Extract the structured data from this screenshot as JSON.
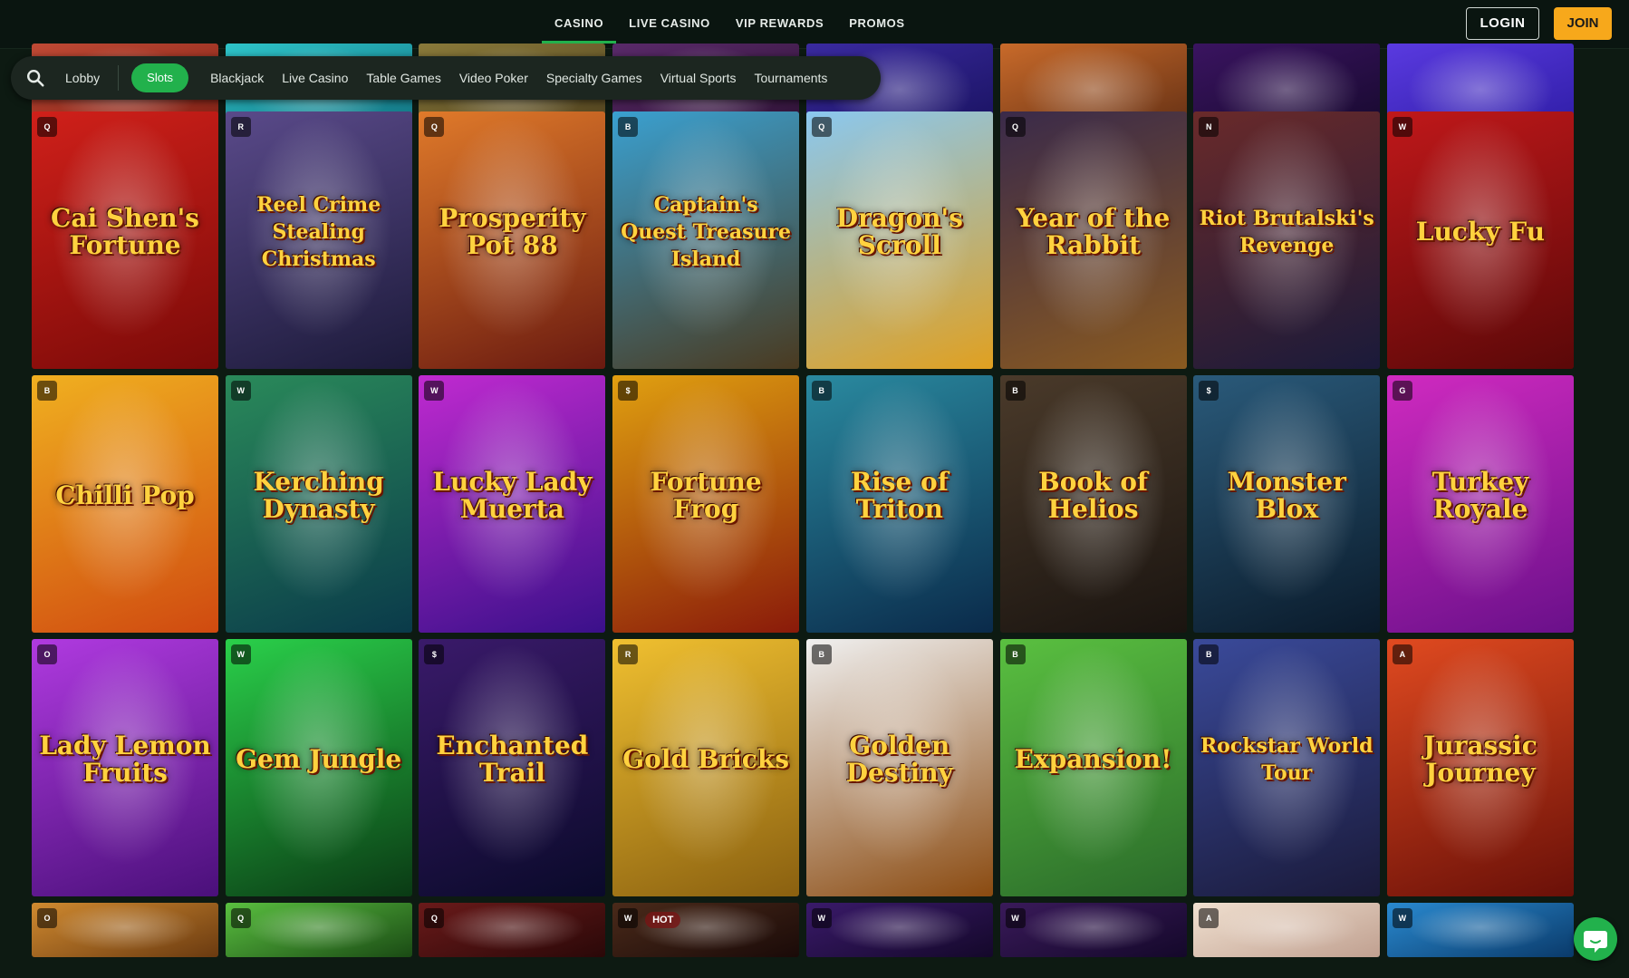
{
  "nav": {
    "items": [
      {
        "label": "CASINO",
        "active": true
      },
      {
        "label": "LIVE CASINO",
        "active": false
      },
      {
        "label": "VIP REWARDS",
        "active": false
      },
      {
        "label": "PROMOS",
        "active": false
      }
    ],
    "login_label": "LOGIN",
    "join_label": "JOIN"
  },
  "filters": {
    "lobby_label": "Lobby",
    "active_label": "Slots",
    "items": [
      "Blackjack",
      "Live Casino",
      "Table Games",
      "Video Poker",
      "Specialty Games",
      "Virtual Sports",
      "Tournaments"
    ]
  },
  "colors": {
    "accent": "#22b14c",
    "join": "#f7a81b",
    "background": "#0d1a12"
  },
  "rows": [
    {
      "tiles": [
        {
          "title": "",
          "bg": [
            "#c04a35",
            "#7a1c12"
          ],
          "prov": ""
        },
        {
          "title": "",
          "bg": [
            "#2ec4c9",
            "#0f6a7a"
          ],
          "prov": ""
        },
        {
          "title": "",
          "bg": [
            "#8a7a3a",
            "#4a3c1c"
          ],
          "prov": ""
        },
        {
          "title": "",
          "bg": [
            "#5a2a6a",
            "#2a1030"
          ],
          "prov": ""
        },
        {
          "title": "",
          "bg": [
            "#3a2aa0",
            "#16105a"
          ],
          "prov": ""
        },
        {
          "title": "",
          "bg": [
            "#c86a2a",
            "#5a2a12"
          ],
          "prov": ""
        },
        {
          "title": "",
          "bg": [
            "#3a1460",
            "#14082a"
          ],
          "prov": ""
        },
        {
          "title": "",
          "bg": [
            "#5a3ae0",
            "#2a1aa0"
          ],
          "prov": ""
        }
      ]
    },
    {
      "tiles": [
        {
          "title": "Cai Shen's Fortune",
          "bg": [
            "#d0201a",
            "#7a0a08"
          ],
          "prov": "Q"
        },
        {
          "title": "Reel Crime Stealing Christmas",
          "bg": [
            "#5a4a8a",
            "#1c1a3a"
          ],
          "prov": "R"
        },
        {
          "title": "Prosperity Pot 88",
          "bg": [
            "#e07a2a",
            "#6a1a10"
          ],
          "prov": "Q"
        },
        {
          "title": "Captain's Quest Treasure Island",
          "bg": [
            "#3aa0d0",
            "#4a3a20"
          ],
          "prov": "B"
        },
        {
          "title": "Dragon's Scroll",
          "bg": [
            "#8ac8f0",
            "#e0a020"
          ],
          "prov": "Q"
        },
        {
          "title": "Year of the Rabbit",
          "bg": [
            "#3a2a4a",
            "#8a5a20"
          ],
          "prov": "Q"
        },
        {
          "title": "Riot Brutalski's Revenge",
          "bg": [
            "#6a2a2a",
            "#1a1a3a"
          ],
          "prov": "N"
        },
        {
          "title": "Lucky Fu",
          "bg": [
            "#c0181a",
            "#5a0808"
          ],
          "prov": "W"
        }
      ]
    },
    {
      "tiles": [
        {
          "title": "Chilli Pop",
          "bg": [
            "#f0b020",
            "#d04a10"
          ],
          "prov": "B"
        },
        {
          "title": "Kerching Dynasty",
          "bg": [
            "#2a8a5a",
            "#0a3a4a"
          ],
          "prov": "W"
        },
        {
          "title": "Lucky Lady Muerta",
          "bg": [
            "#c02ad0",
            "#3a108a"
          ],
          "prov": "W"
        },
        {
          "title": "Fortune Frog",
          "bg": [
            "#e0a010",
            "#8a1a0a"
          ],
          "prov": "$"
        },
        {
          "title": "Rise of Triton",
          "bg": [
            "#2a8aa0",
            "#0a2a4a"
          ],
          "prov": "B"
        },
        {
          "title": "Book of Helios",
          "bg": [
            "#4a3a2a",
            "#1a1410"
          ],
          "prov": "B"
        },
        {
          "title": "Monster Blox",
          "bg": [
            "#2a5a7a",
            "#0a1a2a"
          ],
          "prov": "$"
        },
        {
          "title": "Turkey Royale",
          "bg": [
            "#d02ac0",
            "#6a108a"
          ],
          "prov": "G"
        }
      ]
    },
    {
      "tiles": [
        {
          "title": "Lady Lemon Fruits",
          "bg": [
            "#b03ae0",
            "#4a107a"
          ],
          "prov": "O"
        },
        {
          "title": "Gem Jungle",
          "bg": [
            "#2ad04a",
            "#0a3a14"
          ],
          "prov": "W"
        },
        {
          "title": "Enchanted Trail",
          "bg": [
            "#3a1a6a",
            "#0a0a2a"
          ],
          "prov": "$"
        },
        {
          "title": "Gold Bricks",
          "bg": [
            "#f0c030",
            "#8a6010"
          ],
          "prov": "R"
        },
        {
          "title": "Golden Destiny",
          "bg": [
            "#f0f0f0",
            "#8a4a10"
          ],
          "prov": "B"
        },
        {
          "title": "Expansion!",
          "bg": [
            "#5ac040",
            "#2a6a2a"
          ],
          "prov": "B"
        },
        {
          "title": "Rockstar World Tour",
          "bg": [
            "#3a4a9a",
            "#1a1a3a"
          ],
          "prov": "B"
        },
        {
          "title": "Jurassic Journey",
          "bg": [
            "#e04a20",
            "#6a1008"
          ],
          "prov": "A"
        }
      ]
    },
    {
      "tiles": [
        {
          "title": "",
          "bg": [
            "#d08a30",
            "#6a3a10"
          ],
          "prov": "O"
        },
        {
          "title": "",
          "bg": [
            "#5ac040",
            "#1a4a14"
          ],
          "prov": "Q"
        },
        {
          "title": "",
          "bg": [
            "#6a1a1a",
            "#2a0808"
          ],
          "prov": "Q"
        },
        {
          "title": "",
          "bg": [
            "#4a2a1a",
            "#1a0a08"
          ],
          "prov": "W",
          "hot": "HOT"
        },
        {
          "title": "",
          "bg": [
            "#3a1a6a",
            "#14082a"
          ],
          "prov": "W"
        },
        {
          "title": "",
          "bg": [
            "#3a1a5a",
            "#14082a"
          ],
          "prov": "W"
        },
        {
          "title": "",
          "bg": [
            "#f0e0d0",
            "#c0a090"
          ],
          "prov": "A"
        },
        {
          "title": "",
          "bg": [
            "#2a8ad0",
            "#0a3a6a"
          ],
          "prov": "W"
        }
      ]
    }
  ]
}
